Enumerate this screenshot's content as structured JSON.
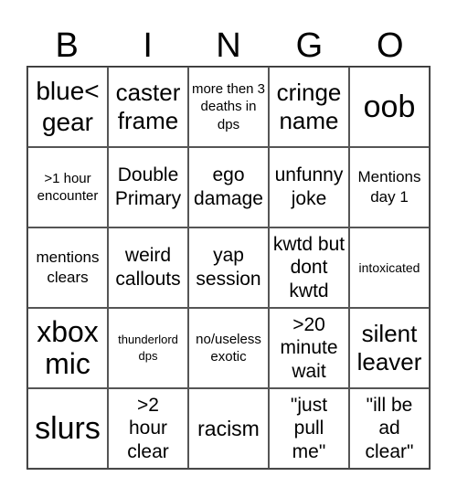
{
  "header": {
    "letters": [
      "B",
      "I",
      "N",
      "G",
      "O"
    ]
  },
  "cells": [
    "blue< gear",
    "caster frame",
    "more then 3 deaths in dps",
    "cringe name",
    "oob",
    ">1 hour encounter",
    "Double Primary",
    "ego damage",
    "unfunny joke",
    "Mentions day 1",
    "mentions clears",
    "weird callouts",
    "yap session",
    "kwtd but dont kwtd",
    "intoxicated",
    "xbox mic",
    "thunderlord dps",
    "no/useless exotic",
    ">20 minute wait",
    "silent leaver",
    "slurs",
    ">2 hour clear",
    "racism",
    "\"just pull me\"",
    "\"ill be ad clear\""
  ]
}
